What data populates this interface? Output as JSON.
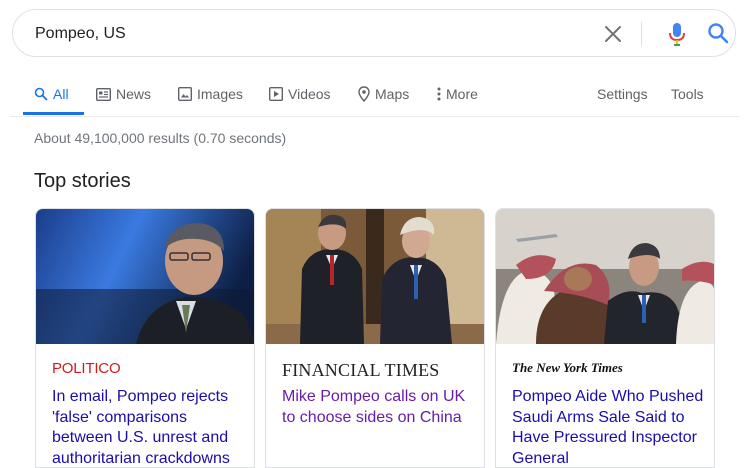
{
  "search": {
    "query": "Pompeo, US"
  },
  "tabs": [
    {
      "label": "All",
      "icon": "search-icon",
      "active": true
    },
    {
      "label": "News",
      "icon": "news-icon"
    },
    {
      "label": "Images",
      "icon": "image-icon"
    },
    {
      "label": "Videos",
      "icon": "video-icon"
    },
    {
      "label": "Maps",
      "icon": "map-pin-icon"
    },
    {
      "label": "More",
      "icon": "more-vertical-icon"
    }
  ],
  "tools": {
    "settings_label": "Settings",
    "tools_label": "Tools"
  },
  "result_stats": "About 49,100,000 results (0.70 seconds)",
  "top_stories": {
    "title": "Top stories",
    "cards": [
      {
        "source": "POLITICO",
        "headline": "In email, Pompeo rejects 'false' comparisons between U.S. unrest and authoritarian crackdowns",
        "visited": false
      },
      {
        "source": "FINANCIAL TIMES",
        "headline": "Mike Pompeo calls on UK to choose sides on China",
        "visited": true
      },
      {
        "source": "The New York Times",
        "headline": "Pompeo Aide Who Pushed Saudi Arms Sale Said to Have Pressured Inspector General",
        "visited": false
      }
    ]
  },
  "colors": {
    "accent": "#1a73e8",
    "link": "#1a0dab",
    "visited_link": "#681da8",
    "muted_text": "#70757a",
    "politico_red": "#d01b1b"
  }
}
